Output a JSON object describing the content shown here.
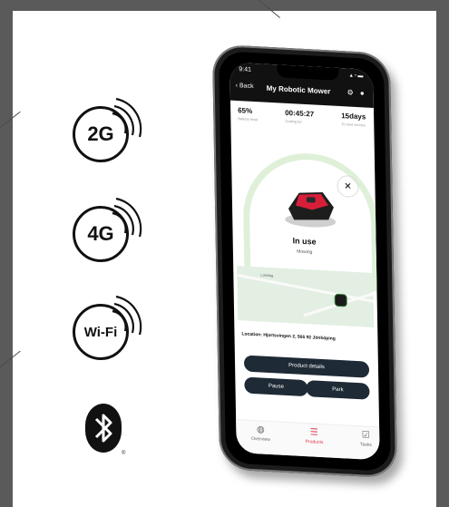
{
  "connectivity": [
    {
      "label": "2G",
      "icon": "signal-waves-icon"
    },
    {
      "label": "4G",
      "icon": "signal-waves-icon"
    },
    {
      "label": "Wi-Fi",
      "icon": "signal-waves-icon"
    }
  ],
  "bluetooth": {
    "icon": "bluetooth-icon",
    "mark": "®"
  },
  "phone": {
    "time": "9:41",
    "back_label": "Back",
    "title": "My Robotic Mower",
    "stats": [
      {
        "value": "65%",
        "caption": "Battery level"
      },
      {
        "value": "00:45:27",
        "caption": "Cutting for"
      },
      {
        "value": "15days",
        "caption": "To next service"
      }
    ],
    "status_title": "In use",
    "status_sub": "Mowing",
    "map_label": "Lokalag",
    "location": "Location: Hjortsvingen 2, 566 92 Jönköping",
    "buttons": {
      "product_details": "Product details",
      "pause": "Pause",
      "park": "Park"
    },
    "tabs": [
      {
        "label": "Overview",
        "icon": "globe-icon"
      },
      {
        "label": "Products",
        "icon": "list-icon",
        "active": true
      },
      {
        "label": "Tasks",
        "icon": "checkbox-icon"
      }
    ]
  },
  "colors": {
    "accent": "#e0334a",
    "button": "#1e2a35",
    "arc": "#dff0d8"
  }
}
